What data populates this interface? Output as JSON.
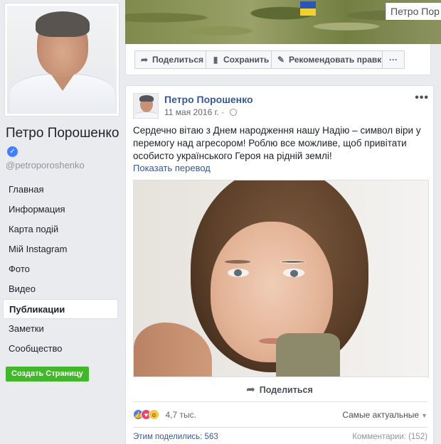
{
  "profile": {
    "name": "Петро Порошенко",
    "handle": "@petroporoshenko",
    "verified_icon": "check-icon"
  },
  "nav": {
    "items": [
      {
        "label": "Главная"
      },
      {
        "label": "Информация"
      },
      {
        "label": "Карта подій"
      },
      {
        "label": "Мій Instagram"
      },
      {
        "label": "Фото"
      },
      {
        "label": "Видео"
      },
      {
        "label": "Публикации",
        "active": true
      },
      {
        "label": "Заметки"
      },
      {
        "label": "Сообщество"
      }
    ],
    "create_page": "Создать Страницу"
  },
  "cover": {
    "name_tag": "Петро Пор"
  },
  "actions": {
    "share": "Поделиться",
    "save": "Сохранить",
    "suggest": "Рекомендовать правки",
    "more": "···"
  },
  "post": {
    "author": "Петро Порошенко",
    "date": "11 мая 2016 г.",
    "text": "Сердечно вітаю з Днем народження нашу Надію – символ віри у перемогу над агресором! Роблю все можливе, щоб привітати особисто українського Героя на рідній землі!",
    "translate": "Показать перевод",
    "share_label": "Поделиться",
    "reactions_count": "4,7 тыс.",
    "sort": "Самые актуальные",
    "shares": "Этим поделились: 563",
    "comments": "Комментарии: (152)"
  },
  "colors": {
    "link": "#365899",
    "background": "#e9ebee",
    "create_button": "#42b72a"
  }
}
